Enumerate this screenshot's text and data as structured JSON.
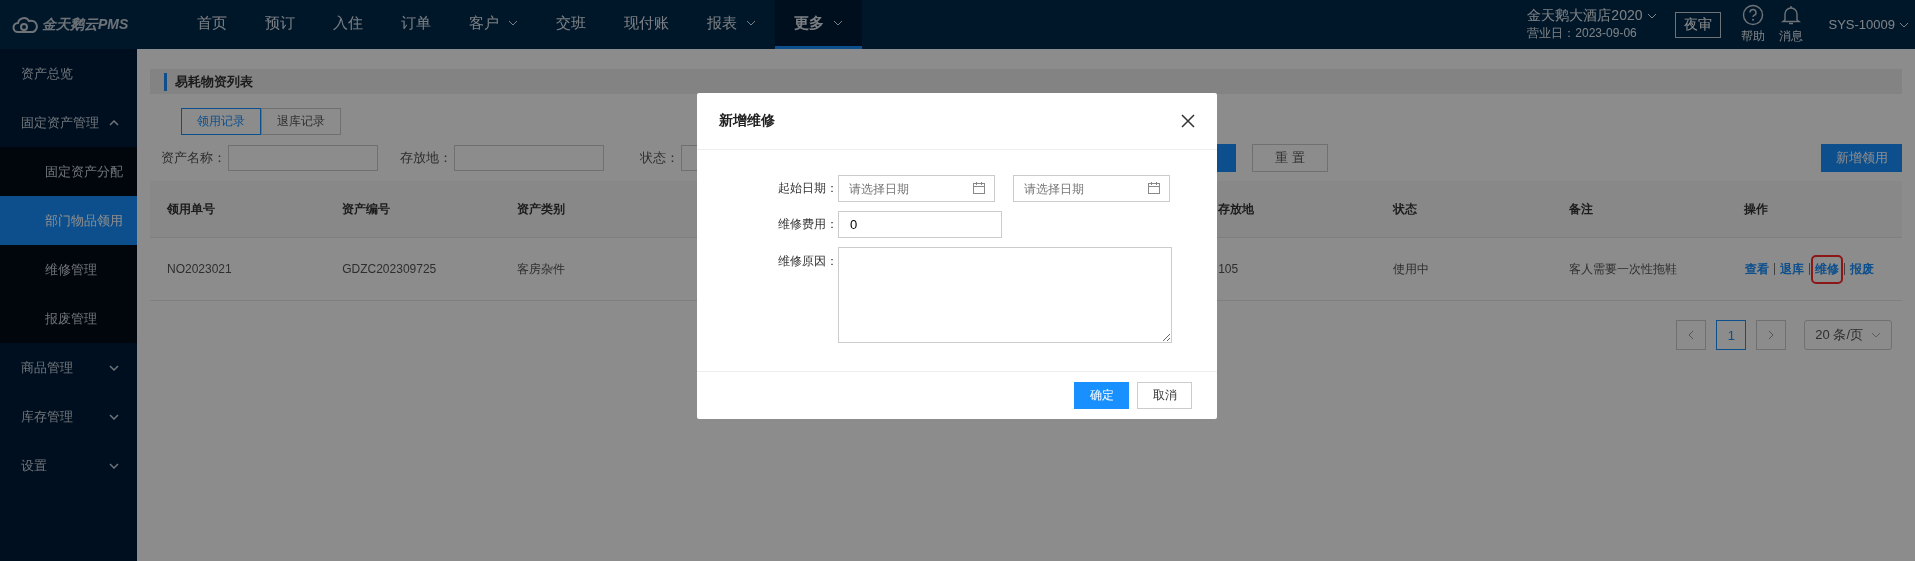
{
  "topbar": {
    "logo": "金天鹅云PMS",
    "nav": [
      {
        "label": "首页",
        "selected": false,
        "dropdown": false
      },
      {
        "label": "预订",
        "selected": false,
        "dropdown": false
      },
      {
        "label": "入住",
        "selected": false,
        "dropdown": false
      },
      {
        "label": "订单",
        "selected": false,
        "dropdown": false
      },
      {
        "label": "客户",
        "selected": false,
        "dropdown": true
      },
      {
        "label": "交班",
        "selected": false,
        "dropdown": false
      },
      {
        "label": "现付账",
        "selected": false,
        "dropdown": false
      },
      {
        "label": "报表",
        "selected": false,
        "dropdown": true
      },
      {
        "label": "更多",
        "selected": true,
        "dropdown": true
      }
    ],
    "hotel": "金天鹅大酒店2020",
    "business_day": "营业日：2023-09-06",
    "night_audit": "夜审",
    "help": "帮助",
    "messages": "消息",
    "user": "SYS-10009"
  },
  "sidebar": {
    "items": [
      {
        "label": "资产总览",
        "selected": false
      },
      {
        "label": "固定资产管理",
        "selected": false,
        "expanded": true,
        "children": [
          {
            "label": "固定资产分配",
            "selected": false
          },
          {
            "label": "部门物品领用",
            "selected": true
          },
          {
            "label": "维修管理",
            "selected": false
          },
          {
            "label": "报废管理",
            "selected": false
          }
        ]
      },
      {
        "label": "商品管理",
        "selected": false,
        "expanded": false
      },
      {
        "label": "库存管理",
        "selected": false,
        "expanded": false
      },
      {
        "label": "设置",
        "selected": false,
        "expanded": false
      }
    ]
  },
  "page": {
    "title": "易耗物资列表",
    "tabs": [
      {
        "label": "领用记录",
        "selected": true
      },
      {
        "label": "退库记录",
        "selected": false
      }
    ],
    "filters": [
      {
        "label": "资产名称："
      },
      {
        "label": "存放地："
      }
    ],
    "status_label": "状态：",
    "reset": "重 置",
    "add": "新增领用",
    "table": {
      "left_columns": [
        "领用单号",
        "资产编号",
        "资产类别"
      ],
      "right_columns": [
        "存放地",
        "状态",
        "备注",
        "操作"
      ],
      "rows": [
        {
          "left_cells": [
            "NO2023021",
            "GDZC202309725",
            "客房杂件"
          ],
          "right_cells": [
            "105",
            "使用中",
            "客人需要一次性拖鞋"
          ],
          "actions": [
            {
              "label": "查看",
              "highlighted": false
            },
            {
              "label": "退库",
              "highlighted": false
            },
            {
              "label": "维修",
              "highlighted": true
            },
            {
              "label": "报废",
              "highlighted": false
            }
          ]
        }
      ]
    },
    "pagination": {
      "pages": [
        {
          "label": "1",
          "selected": true
        }
      ],
      "page_size": "20 条/页"
    }
  },
  "dialog": {
    "title": "新增维修",
    "date_label": "起始日期：",
    "date_placeholders": [
      "请选择日期",
      "请选择日期"
    ],
    "cost_label": "维修费用：",
    "cost_value": "0",
    "reason_label": "维修原因：",
    "ok": "确定",
    "cancel": "取消"
  }
}
